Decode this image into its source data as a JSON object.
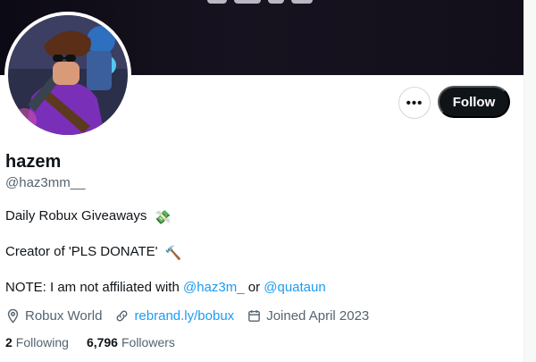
{
  "profile": {
    "display_name": "hazem",
    "handle": "@haz3mm__",
    "bio": {
      "line1": "Daily Robux Giveaways",
      "line1_emoji": "💸",
      "line2": "Creator of 'PLS DONATE'",
      "line2_emoji": "🔨",
      "line3_prefix": "NOTE: I am not affiliated with",
      "line3_mention1": "@haz3m_",
      "line3_or": "or",
      "line3_mention2": "@quataun"
    },
    "location": "Robux World",
    "website": "rebrand.ly/bobux",
    "joined": "Joined April 2023",
    "following_count": "2",
    "following_label": "Following",
    "followers_count": "6,796",
    "followers_label": "Followers"
  },
  "actions": {
    "more_label": "•••",
    "follow_label": "Follow"
  },
  "icons": {
    "location": "location-pin-icon",
    "link": "link-icon",
    "calendar": "calendar-icon",
    "more": "more-options-icon"
  },
  "colors": {
    "text_primary": "#0f1419",
    "text_secondary": "#536471",
    "accent": "#1d9bf0",
    "button_dark": "#0f1419",
    "border": "#cfd9de"
  }
}
